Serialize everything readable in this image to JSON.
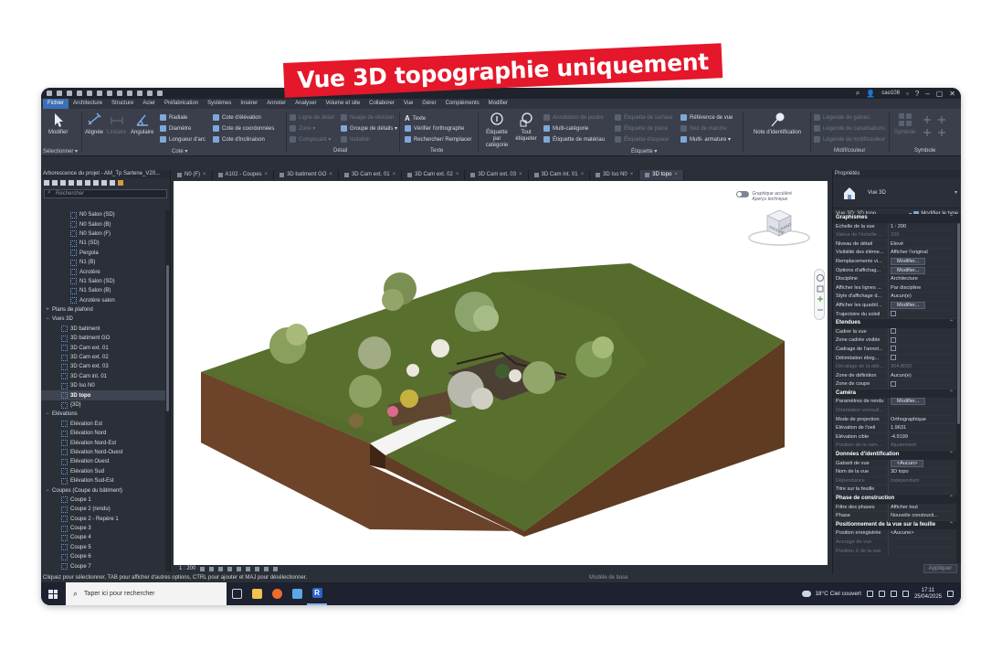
{
  "banner": {
    "text": "Vue 3D topographie uniquement"
  },
  "titlebar": {
    "user": "cao108"
  },
  "menu": {
    "tabs": [
      "Fichier",
      "Architecture",
      "Structure",
      "Acier",
      "Préfabrication",
      "Systèmes",
      "Insérer",
      "Annoter",
      "Analyser",
      "Volume et site",
      "Collaborer",
      "Vue",
      "Gérer",
      "Compléments",
      "Modifier"
    ]
  },
  "ribbon": {
    "modifier": {
      "label": "Modifier",
      "group": "Sélectionner ▾"
    },
    "cote": {
      "alignee": "Alignée",
      "lineaire": "Linéaire",
      "angulaire": "Angulaire",
      "radiale": "Radiale",
      "diametre": "Diamètre",
      "longueur_arc": "Longueur d'arc",
      "cote_elevation": "Cote d'élévation",
      "cote_coordonnees": "Cote de coordonnées",
      "cote_inclinaison": "Cote d'inclinaison",
      "group": "Cote ▾"
    },
    "detail": {
      "ligne_detail": "Ligne de détail",
      "zone": "Zone ▾",
      "composant": "Composant ▾",
      "nuage_revision": "Nuage de révision",
      "groupe_details": "Groupe de détails ▾",
      "isolation": "Isolation",
      "group": "Détail"
    },
    "texte": {
      "texte": "Texte",
      "verifier": "Vérifier l'orthographe",
      "rechercher": "Rechercher/ Remplacer",
      "group": "Texte"
    },
    "etiquette": {
      "par_categorie": "Étiquette par catégorie",
      "tout_etiqueter": "Tout étiqueter",
      "annotation_poutre": "Annotation de poutre",
      "multi_categorie": "Multi-catégorie",
      "etiquette_materiau": "Étiquette de matériau",
      "etiquette_surface": "Étiquette de surface",
      "etiquette_piece": "Étiquette de pièce",
      "etiquette_espace": "Étiquette d'espace",
      "reference_vue": "Référence de vue",
      "nez_marche": "Nez de marche",
      "multi_armature": "Multi- armature ▾",
      "group": "Étiquette ▾"
    },
    "motif": {
      "note_identification": "Note d'identification",
      "legende_gaines": "Légende de gaines",
      "legende_canalisations": "Légende de canalisations",
      "legende_motif": "Légende de motif/couleur",
      "group": "Motif/couleur"
    },
    "symbole": {
      "label": "Symbole",
      "group": "Symbole"
    }
  },
  "browser": {
    "title": "Arborescence du projet - AM_Tp Sartene_V20...",
    "search_placeholder": "Rechercher",
    "items": [
      {
        "label": "N0 Salon (SD)",
        "level": 3,
        "type": "view"
      },
      {
        "label": "N0 Salon (B)",
        "level": 3,
        "type": "view"
      },
      {
        "label": "N0 Salon (F)",
        "level": 3,
        "type": "view"
      },
      {
        "label": "N1 (SD)",
        "level": 3,
        "type": "view"
      },
      {
        "label": "Pergola",
        "level": 3,
        "type": "view"
      },
      {
        "label": "N1 (B)",
        "level": 3,
        "type": "view"
      },
      {
        "label": "Acrotère",
        "level": 3,
        "type": "view"
      },
      {
        "label": "N1 Salon (SD)",
        "level": 3,
        "type": "view"
      },
      {
        "label": "N1 Salon (B)",
        "level": 3,
        "type": "view"
      },
      {
        "label": "Acrotère salon",
        "level": 3,
        "type": "view"
      },
      {
        "label": "Plans de plafond",
        "level": 1,
        "type": "folder",
        "expander": "+"
      },
      {
        "label": "Vues 3D",
        "level": 1,
        "type": "folder",
        "expander": "−"
      },
      {
        "label": "3D batiment",
        "level": 2,
        "type": "view"
      },
      {
        "label": "3D batiment GO",
        "level": 2,
        "type": "view"
      },
      {
        "label": "3D Cam ext. 01",
        "level": 2,
        "type": "view"
      },
      {
        "label": "3D Cam ext. 02",
        "level": 2,
        "type": "view"
      },
      {
        "label": "3D Cam ext. 03",
        "level": 2,
        "type": "view"
      },
      {
        "label": "3D Cam int. 01",
        "level": 2,
        "type": "view"
      },
      {
        "label": "3D Iso N0",
        "level": 2,
        "type": "view"
      },
      {
        "label": "3D topo",
        "level": 2,
        "type": "view",
        "selected": true
      },
      {
        "label": "{3D}",
        "level": 2,
        "type": "view"
      },
      {
        "label": "Elévations",
        "level": 1,
        "type": "folder",
        "expander": "−"
      },
      {
        "label": "Elévation Est",
        "level": 2,
        "type": "view"
      },
      {
        "label": "Elévation Nord",
        "level": 2,
        "type": "view"
      },
      {
        "label": "Elévation Nord-Est",
        "level": 2,
        "type": "view"
      },
      {
        "label": "Elévation Nord-Ouest",
        "level": 2,
        "type": "view"
      },
      {
        "label": "Elévation Ouest",
        "level": 2,
        "type": "view"
      },
      {
        "label": "Elévation Sud",
        "level": 2,
        "type": "view"
      },
      {
        "label": "Elévation Sud-Est",
        "level": 2,
        "type": "view"
      },
      {
        "label": "Coupes (Coupe du bâtiment)",
        "level": 1,
        "type": "folder",
        "expander": "−"
      },
      {
        "label": "Coupe 1",
        "level": 2,
        "type": "view"
      },
      {
        "label": "Coupe 2 (rendu)",
        "level": 2,
        "type": "view"
      },
      {
        "label": "Coupe 2 - Repère 1",
        "level": 2,
        "type": "view"
      },
      {
        "label": "Coupe 3",
        "level": 2,
        "type": "view"
      },
      {
        "label": "Coupe 4",
        "level": 2,
        "type": "view"
      },
      {
        "label": "Coupe 5",
        "level": 2,
        "type": "view"
      },
      {
        "label": "Coupe 6",
        "level": 2,
        "type": "view"
      },
      {
        "label": "Coupe 7",
        "level": 2,
        "type": "view"
      }
    ]
  },
  "viewtabs": [
    {
      "label": "N0 (F)"
    },
    {
      "label": "A102 - Coupes"
    },
    {
      "label": "3D batiment GO"
    },
    {
      "label": "3D Cam ext. 01"
    },
    {
      "label": "3D Cam ext. 02"
    },
    {
      "label": "3D Cam ext. 03"
    },
    {
      "label": "3D Cam int. 01"
    },
    {
      "label": "3D Iso N0"
    },
    {
      "label": "3D topo",
      "active": true
    }
  ],
  "viewport": {
    "toggle_line1": "Graphique accéléré",
    "toggle_line2": "Aperçu technique",
    "viewcube_left": "GAUCHE",
    "viewcube_right": "AVANT"
  },
  "viewstatus": {
    "scale": "1 : 200"
  },
  "statusline": {
    "hint": "Cliquez pour sélectionner, TAB pour afficher d'autres options, CTRL pour ajouter et MAJ pour désélectionner.",
    "model": "Modèle de base"
  },
  "properties": {
    "title": "Propriétés",
    "view_type": "Vue 3D",
    "filter": "Vue 3D: 3D topo",
    "edit_type": "Modifier le type",
    "sections": [
      {
        "title": "Graphismes",
        "rows": [
          {
            "k": "Echelle de la vue",
            "v": "1 : 200"
          },
          {
            "k": "Valeur de l'échelle ...",
            "v": "200",
            "dim": true
          },
          {
            "k": "Niveau de détail",
            "v": "Elevé"
          },
          {
            "k": "Visibilité des éléme...",
            "v": "Afficher l'original"
          },
          {
            "k": "Remplacements vi...",
            "btn": "Modifier..."
          },
          {
            "k": "Options d'affichag...",
            "btn": "Modifier..."
          },
          {
            "k": "Discipline",
            "v": "Architecture"
          },
          {
            "k": "Afficher les lignes ...",
            "v": "Par discipline"
          },
          {
            "k": "Style d'affichage d...",
            "v": "Aucun(e)"
          },
          {
            "k": "Afficher les quadril...",
            "btn": "Modifier..."
          },
          {
            "k": "Trajectoire du soleil",
            "check": true
          }
        ]
      },
      {
        "title": "Etendues",
        "rows": [
          {
            "k": "Cadrer la vue",
            "check": true
          },
          {
            "k": "Zone cadrée visible",
            "check": true
          },
          {
            "k": "Cadrage de l'annot...",
            "check": true
          },
          {
            "k": "Délimitation éloig...",
            "check": true
          },
          {
            "k": "Décalage de la déli...",
            "v": "304.8000",
            "dim": true
          },
          {
            "k": "Zone de définition",
            "v": "Aucun(e)"
          },
          {
            "k": "Zone de coupe",
            "check": true
          }
        ]
      },
      {
        "title": "Caméra",
        "rows": [
          {
            "k": "Paramètres de rendu",
            "btn": "Modifier..."
          },
          {
            "k": "Orientation verrouil...",
            "v": "",
            "dim": true
          },
          {
            "k": "Mode de projection",
            "v": "Orthographique"
          },
          {
            "k": "Elévation de l'oeil",
            "v": "1.9631"
          },
          {
            "k": "Elévation cible",
            "v": "-4.9199"
          },
          {
            "k": "Position de la cam...",
            "v": "Ajustement",
            "dim": true
          }
        ]
      },
      {
        "title": "Données d'identification",
        "rows": [
          {
            "k": "Gabarit de vue",
            "btn": "<Aucun>"
          },
          {
            "k": "Nom de la vue",
            "v": "3D topo"
          },
          {
            "k": "Dépendance",
            "v": "Indépendant",
            "dim": true
          },
          {
            "k": "Titre sur la feuille",
            "v": ""
          }
        ]
      },
      {
        "title": "Phase de construction",
        "rows": [
          {
            "k": "Filtre des phases",
            "v": "Afficher tout"
          },
          {
            "k": "Phase",
            "v": "Nouvelle constructi..."
          }
        ]
      },
      {
        "title": "Positionnement de la vue sur la feuille",
        "rows": [
          {
            "k": "Position enregistrée",
            "v": "<Aucune>"
          },
          {
            "k": "Ancrage de vue",
            "v": "",
            "dim": true
          },
          {
            "k": "Position X de la vue",
            "v": "",
            "dim": true
          }
        ]
      }
    ],
    "apply": "Appliquer"
  },
  "taskbar": {
    "search_placeholder": "Taper ici pour rechercher",
    "weather": "18°C  Ciel couvert",
    "time": "17:11",
    "date": "25/04/2025"
  }
}
